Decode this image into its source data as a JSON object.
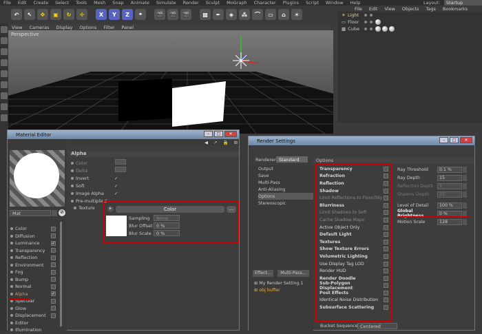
{
  "menubar": {
    "items": [
      "File",
      "Edit",
      "Create",
      "Select",
      "Tools",
      "Mesh",
      "Snap",
      "Animate",
      "Simulate",
      "Render",
      "Sculpt",
      "MoGraph",
      "Character",
      "Plugins",
      "Script",
      "Window",
      "Help"
    ],
    "layout_label": "Layout:",
    "layout_value": "Startup"
  },
  "toolbar": {
    "axis_x": "X",
    "axis_y": "Y",
    "axis_z": "Z"
  },
  "viewport": {
    "menu": [
      "View",
      "Cameras",
      "Display",
      "Options",
      "Filter",
      "Panel"
    ],
    "label": "Perspective"
  },
  "object_manager": {
    "tabs": [
      "File",
      "Edit",
      "View",
      "Objects",
      "Tags",
      "Bookmarks"
    ],
    "objects": [
      "Light",
      "Floor",
      "Cube"
    ]
  },
  "material_editor": {
    "title": "Material Editor",
    "mat_name": "Mat",
    "channels": [
      {
        "label": "Color",
        "checked": false
      },
      {
        "label": "Diffusion",
        "checked": false
      },
      {
        "label": "Luminance",
        "checked": true
      },
      {
        "label": "Transparency",
        "checked": false
      },
      {
        "label": "Reflection",
        "checked": false
      },
      {
        "label": "Environment",
        "checked": false
      },
      {
        "label": "Fog",
        "checked": false
      },
      {
        "label": "Bump",
        "checked": false
      },
      {
        "label": "Normal",
        "checked": false
      },
      {
        "label": "Alpha",
        "checked": true,
        "selected": true
      },
      {
        "label": "Specular",
        "checked": false
      },
      {
        "label": "Glow",
        "checked": false
      },
      {
        "label": "Displacement",
        "checked": false
      },
      {
        "label": "Editor",
        "checked": null
      },
      {
        "label": "Illumination",
        "checked": null
      }
    ],
    "section": "Alpha",
    "props": [
      {
        "label": "Color",
        "value": ""
      },
      {
        "label": "Delta",
        "value": ""
      },
      {
        "label": "Invert",
        "value": "✓"
      },
      {
        "label": "Soft",
        "value": "✓"
      },
      {
        "label": "Image Alpha",
        "value": "✓"
      },
      {
        "label": "Pre-multiplied",
        "value": ""
      }
    ],
    "texture_label": "Texture",
    "texture_button": "Color",
    "sampling_label": "Sampling",
    "sampling_value": "None",
    "blur_offset_label": "Blur Offset",
    "blur_offset_value": "0 %",
    "blur_scale_label": "Blur Scale",
    "blur_scale_value": "0 %"
  },
  "render_settings": {
    "title": "Render Settings",
    "renderer_label": "Renderer",
    "renderer_value": "Standard",
    "nav": [
      "Output",
      "Save",
      "Multi-Pass",
      "Anti-Aliasing",
      "Options",
      "Stereoscopic"
    ],
    "selected_nav": "Options",
    "effect_button": "Effect...",
    "multipass_button": "Multi-Pass...",
    "setting_name": "My Render Setting.1",
    "obj_buffer": "obj buffer",
    "options_header": "Options",
    "options": [
      {
        "label": "Transparency",
        "style": "bold"
      },
      {
        "label": "Refraction",
        "style": "bold"
      },
      {
        "label": "Reflection",
        "style": "bold"
      },
      {
        "label": "Shadow",
        "style": "bold"
      },
      {
        "label": "Limit Reflections to Floor/Sky",
        "style": "dim"
      },
      {
        "label": "Blurriness",
        "style": "bold"
      },
      {
        "label": "Limit Shadows to Soft",
        "style": "dim"
      },
      {
        "label": "Cache Shadow Maps",
        "style": "dim"
      },
      {
        "label": "Active Object Only",
        "style": "norm"
      },
      {
        "label": "Default Light",
        "style": "bold"
      },
      {
        "label": "Textures",
        "style": "bold"
      },
      {
        "label": "Show Texture Errors",
        "style": "bold"
      },
      {
        "label": "Volumetric Lighting",
        "style": "bold"
      },
      {
        "label": "Use Display Tag LOD",
        "style": "norm"
      },
      {
        "label": "Render HUD",
        "style": "norm"
      },
      {
        "label": "Render Doodle",
        "style": "bold"
      },
      {
        "label": "Sub-Polygon Displacement",
        "style": "bold"
      },
      {
        "label": "Post Effects",
        "style": "bold"
      },
      {
        "label": "Identical Noise Distribution",
        "style": "norm"
      },
      {
        "label": "Subsurface Scattering",
        "style": "bold"
      }
    ],
    "right_fields": [
      {
        "label": "Ray Threshold",
        "value": "0.1 %",
        "dim": false
      },
      {
        "label": "Ray Depth",
        "value": "15",
        "dim": false
      },
      {
        "label": "Reflection Depth",
        "value": "5",
        "dim": true
      },
      {
        "label": "Shadow Depth",
        "value": "15",
        "dim": true
      }
    ],
    "lod_label": "Level of Detail",
    "lod_value": "100 %",
    "gb_label": "Global Brightness",
    "gb_value": "0 %",
    "ms_label": "Motion Scale",
    "ms_value": "128",
    "bucket_label": "Bucket Sequence",
    "bucket_value": "Centered"
  }
}
